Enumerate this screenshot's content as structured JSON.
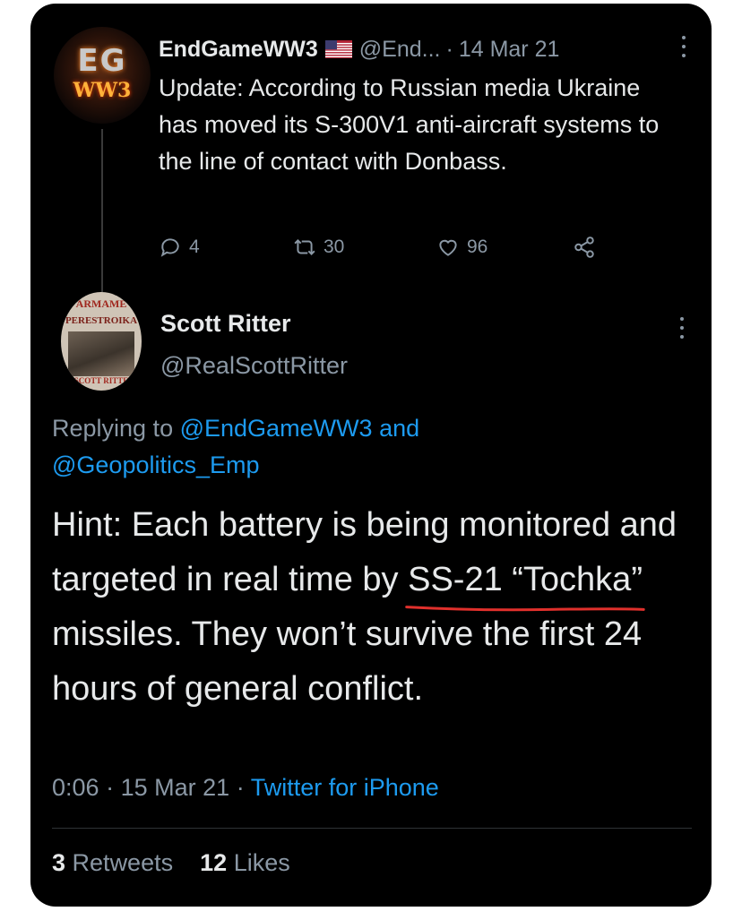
{
  "parent_tweet": {
    "display_name": "EndGameWW3",
    "handle": "@End...",
    "separator": "·",
    "date": "14 Mar 21",
    "text": "Update: According to Russian media Ukraine has moved its S-300V1 anti-aircraft systems to the line of contact with Donbass.",
    "avatar_text_top": "EG",
    "avatar_text_bottom": "WW3",
    "replies": "4",
    "retweets": "30",
    "likes": "96",
    "icons": [
      "reply-icon",
      "retweet-icon",
      "heart-icon",
      "share-icon",
      "us-flag-icon",
      "more-icon"
    ]
  },
  "reply_tweet": {
    "display_name": "Scott Ritter",
    "handle": "@RealScottRitter",
    "avatar_text_top": "ARMAME",
    "avatar_text_title": "PERESTROIKA",
    "avatar_text_bottom": "SCOTT RITTE",
    "replying_prefix": "Replying to",
    "replying_user_1": "@EndGameWW3",
    "replying_and": "and",
    "replying_user_2": "@Geopolitics_Emp",
    "text_before": "Hint: Each battery is being monitored and targeted in real time by ",
    "text_underlined": "SS-21 “Tochka”",
    "text_after": " missiles. They won’t survive the first 24 hours of general conflict.",
    "time": "0:06",
    "meta_separator": "·",
    "date": "15 Mar 21",
    "source": "Twitter for iPhone",
    "retweet_count": "3",
    "retweet_label": "Retweets",
    "like_count": "12",
    "like_label": "Likes"
  },
  "colors": {
    "background": "#000000",
    "text_primary": "#e7e9ea",
    "text_secondary": "#8b98a5",
    "link": "#1d9bf0",
    "underline_annotation": "#e0302c"
  }
}
